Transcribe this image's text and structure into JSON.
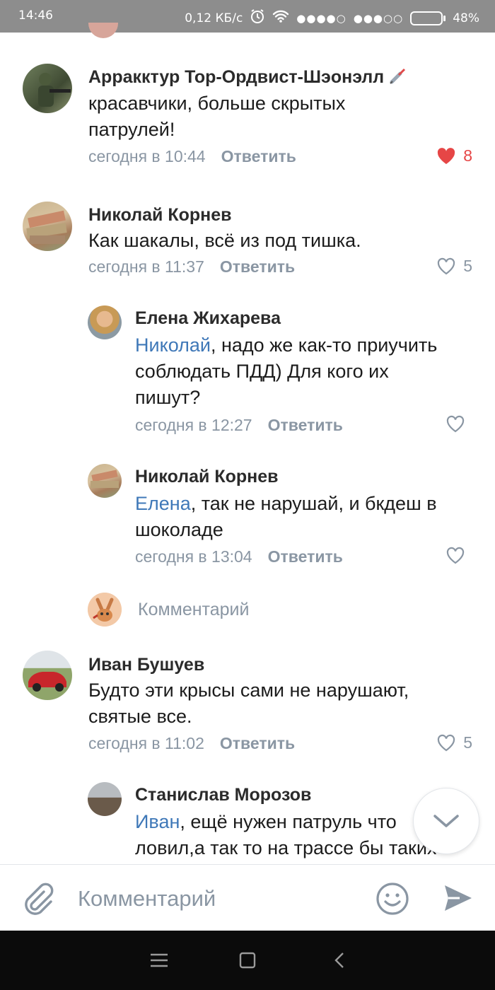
{
  "status_bar": {
    "time": "14:46",
    "network_speed": "0,12 КБ/с",
    "battery_percent": "48%",
    "battery_level": 0.48
  },
  "comments": [
    {
      "author": "Арракктур Тор-Ордвист-Шэонэлл",
      "text_line1": "красавчики, больше скрытых",
      "text_line2": "патрулей!",
      "time": "сегодня в 10:44",
      "reply_label": "Ответить",
      "likes": "8",
      "liked": true
    },
    {
      "author": "Николай Корнев",
      "text_line1": "Как шакалы, всё из под тишка.",
      "time": "сегодня в 11:37",
      "reply_label": "Ответить",
      "likes": "5",
      "liked": false
    },
    {
      "author": "Елена Жихарева",
      "mention": "Николай",
      "text_line1_rest": ", надо же как-то приучить",
      "text_line2": "соблюдать ПДД) Для кого их",
      "text_line3": "пишут?",
      "time": "сегодня в 12:27",
      "reply_label": "Ответить",
      "likes": "",
      "liked": false
    },
    {
      "author": "Николай Корнев",
      "mention": "Елена",
      "text_line1_rest": ", так не нарушай, и бкдеш в",
      "text_line2": "шоколаде",
      "time": "сегодня в 13:04",
      "reply_label": "Ответить",
      "likes": "",
      "liked": false
    },
    {
      "author": "Иван Бушуев",
      "text_line1": "Будто эти крысы сами не нарушают,",
      "text_line2": "святые все.",
      "time": "сегодня в 11:02",
      "reply_label": "Ответить",
      "likes": "5",
      "liked": false
    },
    {
      "author": "Станислав Морозов",
      "mention": "Иван",
      "text_line1_rest": ", ещё нужен патруль что",
      "text_line2": "ловил,а так то на трассе бы таких"
    }
  ],
  "inline_reply_placeholder": "Комментарий",
  "composer": {
    "placeholder": "Комментарий"
  },
  "colors": {
    "accent": "#3f78b8",
    "meta": "#8a96a3",
    "like_active": "#e64646"
  },
  "icons": {
    "attach": "paperclip-icon",
    "emoji": "smiley-icon",
    "send": "send-icon",
    "scroll": "chevron-down-icon"
  }
}
